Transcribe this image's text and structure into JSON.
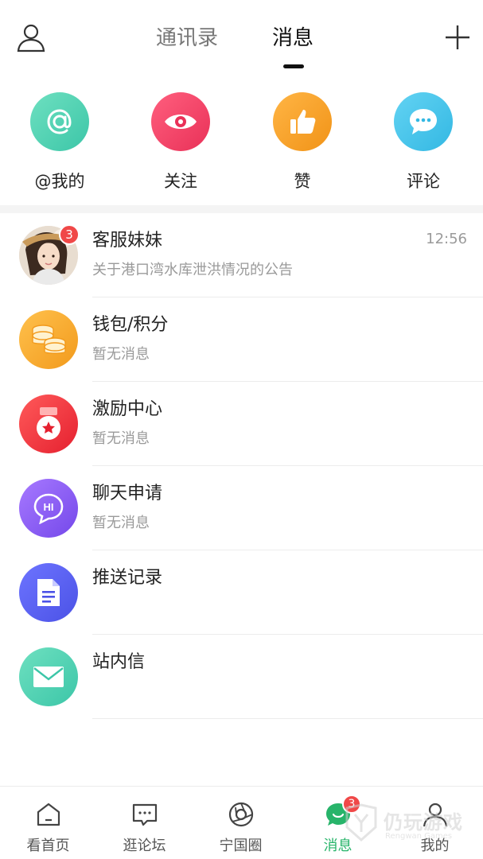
{
  "header": {
    "tabs": [
      {
        "label": "通讯录"
      },
      {
        "label": "消息"
      }
    ]
  },
  "quick_actions": [
    {
      "label": "@我的",
      "icon": "at-icon",
      "color": "#4fd6b8"
    },
    {
      "label": "关注",
      "icon": "eye-icon",
      "color": "#f0456a"
    },
    {
      "label": "赞",
      "icon": "thumbs-up-icon",
      "color": "#f5a623"
    },
    {
      "label": "评论",
      "icon": "comment-icon",
      "color": "#46c8ec"
    }
  ],
  "messages": [
    {
      "title": "客服妹妹",
      "subtitle": "关于港口湾水库泄洪情况的公告",
      "time": "12:56",
      "badge": "3",
      "icon": "avatar-photo"
    },
    {
      "title": "钱包/积分",
      "subtitle": "暂无消息",
      "icon": "coins-icon",
      "color": "#f5a623"
    },
    {
      "title": "激励中心",
      "subtitle": "暂无消息",
      "icon": "medal-icon",
      "color": "#f0304a"
    },
    {
      "title": "聊天申请",
      "subtitle": "暂无消息",
      "icon": "chat-hi-icon",
      "color": "#8a5cf5"
    },
    {
      "title": "推送记录",
      "subtitle": "",
      "icon": "document-icon",
      "color": "#5b63f0"
    },
    {
      "title": "站内信",
      "subtitle": "",
      "icon": "mail-icon",
      "color": "#4fd6b8"
    }
  ],
  "bottom_nav": [
    {
      "label": "看首页",
      "icon": "home-icon"
    },
    {
      "label": "逛论坛",
      "icon": "forum-icon"
    },
    {
      "label": "宁国圈",
      "icon": "circle-icon"
    },
    {
      "label": "消息",
      "icon": "message-icon",
      "badge": "3",
      "active": true
    },
    {
      "label": "我的",
      "icon": "profile-icon"
    }
  ],
  "watermark": {
    "text": "仍玩游戏",
    "sub": "Rengwan Games"
  },
  "colors": {
    "accent_green": "#27b46a",
    "badge_red": "#f04848"
  }
}
